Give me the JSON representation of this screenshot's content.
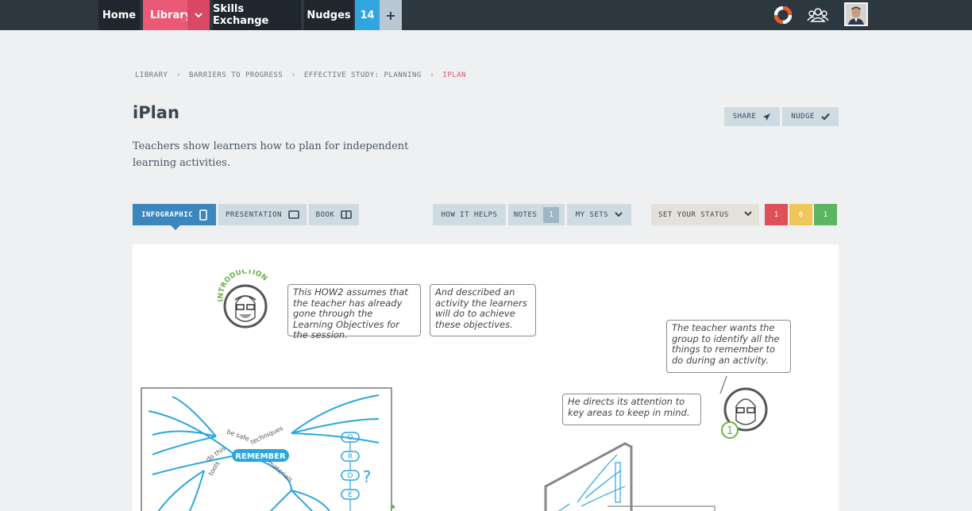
{
  "nav": {
    "home": "Home",
    "library": "Library",
    "skills": "Skills Exchange",
    "nudges": "Nudges",
    "nudge_count": "14",
    "plus": "+"
  },
  "breadcrumb": [
    "LIBRARY",
    "BARRIERS TO PROGRESS",
    "EFFECTIVE STUDY: PLANNING",
    "IPLAN"
  ],
  "page": {
    "title": "iPlan",
    "description": "Teachers show learners how to plan for independent learning activities.",
    "share": "SHARE",
    "nudge": "NUDGE"
  },
  "tabs": {
    "infographic": "INFOGRAPHIC",
    "presentation": "PRESENTATION",
    "book": "BOOK",
    "how_it_helps": "HOW IT HELPS",
    "notes": "NOTES",
    "notes_count": "1",
    "my_sets": "MY SETS"
  },
  "status": {
    "label": "SET YOUR STATUS",
    "red": "1",
    "yellow": "0",
    "green": "1",
    "colors": {
      "red": "#de5158",
      "yellow": "#f0c65a",
      "green": "#5bb562"
    }
  },
  "infographic": {
    "intro_badge": "INTRODUCTION",
    "bubble1": "This HOW2 assumes that the teacher has already gone through the Learning Objectives for the session.",
    "bubble2": "And described an activity the learners will do to achieve these objectives.",
    "bubble3": "The teacher wants the group to identify all the things to remember to do during an activity.",
    "bubble4": "He directs its attention to key areas to keep in mind.",
    "step_number": "1",
    "mindmap_center": "REMEMBER",
    "mindmap_branches": [
      "be safe",
      "techniques",
      "do this",
      "tools",
      "materials"
    ],
    "order_letters": [
      "O",
      "R",
      "D",
      "E"
    ],
    "question_mark": "?"
  },
  "icons": [
    "chevron-down-icon",
    "lifebuoy-icon",
    "people-icon",
    "paper-plane-icon",
    "checkmark-icon",
    "tablet-icon",
    "screen-icon",
    "book-icon"
  ]
}
